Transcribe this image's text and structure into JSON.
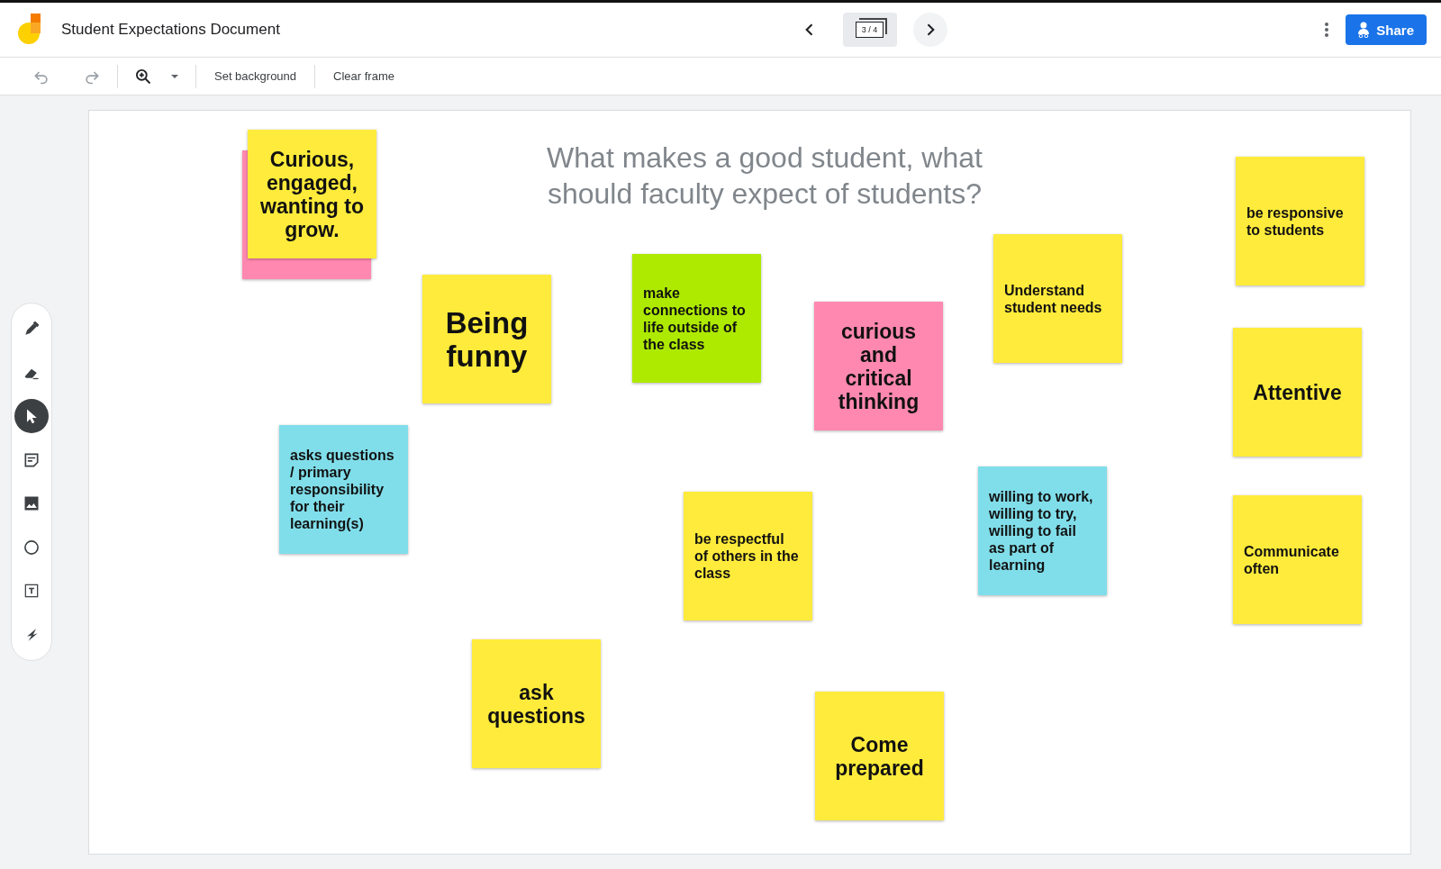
{
  "document_title": "Student Expectations Document",
  "frame_counter": "3 / 4",
  "share_button": "Share",
  "toolbar": {
    "actions": [
      "Set background",
      "Clear frame"
    ]
  },
  "tools": [
    {
      "kind": "pen",
      "selected": false
    },
    {
      "kind": "eraser",
      "selected": false
    },
    {
      "kind": "select",
      "selected": true
    },
    {
      "kind": "note",
      "selected": false
    },
    {
      "kind": "image",
      "selected": false
    },
    {
      "kind": "shape",
      "selected": false
    },
    {
      "kind": "textbox",
      "selected": false
    },
    {
      "kind": "laser",
      "selected": false
    }
  ],
  "frame": {
    "heading": "What makes a good student, what should faculty expect of students?",
    "notes": [
      {
        "kind": "blank",
        "color": "#ff88b0"
      },
      {
        "kind": "large",
        "text": "Curious, engaged, wanting to grow.",
        "color": "#ffeb3b"
      },
      {
        "kind": "huge",
        "text": "Being funny",
        "color": "#ffeb3b"
      },
      {
        "kind": "small",
        "text": "make connections to life outside of the class",
        "color": "#aeea00"
      },
      {
        "kind": "large",
        "text": "curious and critical thinking",
        "color": "#ff88b0"
      },
      {
        "kind": "small",
        "text": "Understand student needs",
        "color": "#ffeb3b"
      },
      {
        "kind": "small",
        "text": "be responsive to students",
        "color": "#ffeb3b"
      },
      {
        "kind": "large",
        "text": "Attentive",
        "color": "#ffeb3b"
      },
      {
        "kind": "small",
        "text": "asks questions / primary responsibility for their learning(s)",
        "color": "#80deea"
      },
      {
        "kind": "small",
        "text": "be respectful of others in the class",
        "color": "#ffeb3b"
      },
      {
        "kind": "small",
        "text": "willing to work, willing to try, willing to fail as part of learning",
        "color": "#80deea"
      },
      {
        "kind": "small",
        "text": "Communicate often",
        "color": "#ffeb3b"
      },
      {
        "kind": "large",
        "text": "ask questions",
        "color": "#ffeb3b"
      },
      {
        "kind": "large",
        "text": "Come prepared",
        "color": "#ffeb3b"
      }
    ]
  }
}
